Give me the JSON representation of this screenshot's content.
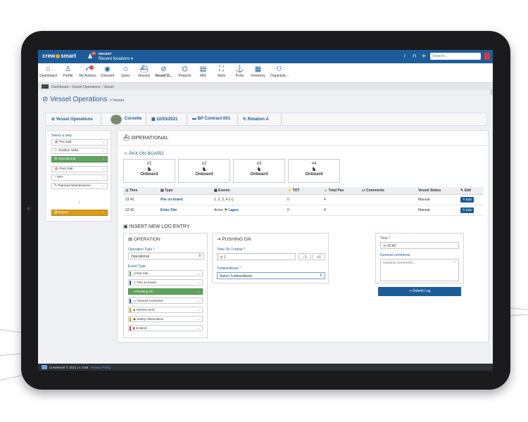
{
  "app": {
    "logo_left": "crew",
    "logo_right": "smart",
    "recent_badge": "85",
    "recent_label": "RECENT",
    "recent_value": "Recent locations ▾",
    "search_placeholder": "Search..."
  },
  "nav": {
    "items": [
      {
        "label": "Dashboard",
        "icon": "⌂"
      },
      {
        "label": "Profile",
        "icon": "♙"
      },
      {
        "label": "My Actions",
        "icon": "✓",
        "badge": "1"
      },
      {
        "label": "Onboard",
        "icon": "◉"
      },
      {
        "label": "Users",
        "icon": "☺"
      },
      {
        "label": "Vessels",
        "icon": "⛴"
      },
      {
        "label": "Vessel D...",
        "icon": "⊘"
      },
      {
        "label": "Projects",
        "icon": "⌬"
      },
      {
        "label": "IMS",
        "icon": "▤"
      },
      {
        "label": "Sites",
        "icon": "⛶"
      },
      {
        "label": "Ports",
        "icon": "⚓"
      },
      {
        "label": "Inventory",
        "icon": "▦"
      },
      {
        "label": "Organisat...",
        "icon": "⚇"
      }
    ]
  },
  "breadcrumb": {
    "items": [
      "Dashboard",
      "Vessel Operations",
      "Vessel"
    ]
  },
  "page": {
    "title": "Vessel Operations",
    "subtitle": "> Vessel"
  },
  "steps_bar": {
    "items": [
      "Vessel Operations",
      "Corvette",
      "22/03/2021",
      "BP Contract 001",
      "Rotation A"
    ]
  },
  "steps": {
    "title": "Select a step",
    "items": [
      "Pre Sail",
      "Toolbox Talks",
      "Operational",
      "Post Sail",
      "KPI",
      "Planned Maintenance"
    ],
    "report_label": "Report"
  },
  "operational": {
    "heading": "OPERATIONAL",
    "pax_title": "PAX ON BOARD",
    "pax": [
      {
        "num": "#1",
        "status": "Onboard"
      },
      {
        "num": "#2",
        "status": "Onboard"
      },
      {
        "num": "#3",
        "status": "Onboard"
      },
      {
        "num": "#4",
        "status": "Onboard"
      }
    ],
    "table": {
      "headers": [
        "Time",
        "Type",
        "Events",
        "TOT",
        "Total Pax",
        "Comments",
        "Vessel Status",
        "Edit"
      ],
      "rows": [
        {
          "time": "22:42",
          "type": "Pax on board",
          "events_text": "1, 2, 3, 4",
          "events_extra": "[+]",
          "tot": "0",
          "total_pax": "4",
          "comments": "",
          "status": "Manual",
          "edit": "Edit"
        },
        {
          "time": "22:42",
          "type": "Enter Site",
          "events_text": "Arrive",
          "events_extra": "Lagos",
          "tot": "0",
          "total_pax": "4",
          "comments": "",
          "status": "Manual",
          "edit": "Edit"
        }
      ]
    }
  },
  "insert_log": {
    "title": "INSERT NEW LOG ENTRY",
    "operation": {
      "heading": "OPERATION",
      "type_label": "Operation Type *",
      "type_value": "Operational",
      "event_label": "Event Type",
      "events": [
        {
          "label": "Exit Site",
          "color": "#5fa45c"
        },
        {
          "label": "Pax on board",
          "color": "#1c5d99"
        },
        {
          "label": "Pushing On",
          "color": "#5fa45c"
        },
        {
          "label": "General Comment",
          "color": "#1c5d99"
        },
        {
          "label": "Perform Drill",
          "color": "#d99a17"
        },
        {
          "label": "Safety Observation",
          "color": "#d99a17"
        },
        {
          "label": "Incident",
          "color": "#d9363e"
        }
      ]
    },
    "pushing": {
      "heading": "PUSHING ON",
      "time_label": "Time On Turbine *",
      "time_value": "1",
      "minus_label": "−1",
      "plus_label": "+1",
      "turbine_label": "Turbine/Asset *",
      "turbine_value": "Select Turbine/Asset"
    },
    "right": {
      "time_label": "Time *",
      "time_value": "22:42",
      "comments_label": "General comments",
      "comments_placeholder": "General comments...",
      "submit_label": "Submit Log"
    }
  },
  "footer": {
    "text": "CrewSmart © 2021 | v. 8.68",
    "link": "Privacy Policy"
  }
}
